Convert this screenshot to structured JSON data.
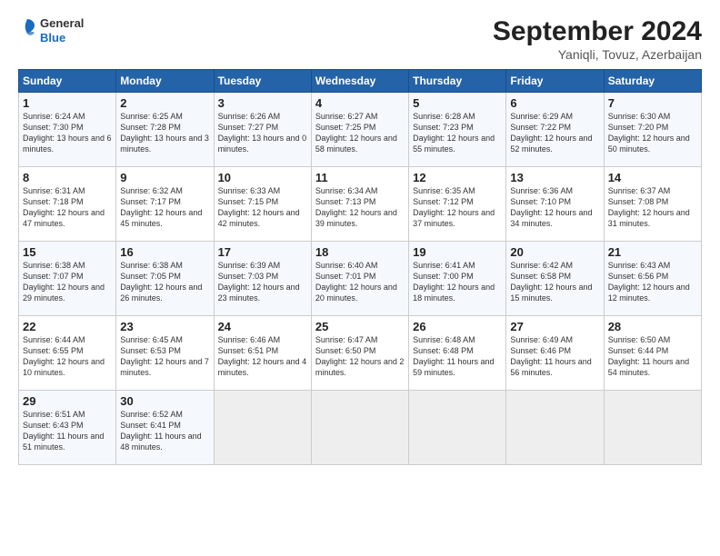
{
  "header": {
    "logo_line1": "General",
    "logo_line2": "Blue",
    "title": "September 2024",
    "subtitle": "Yaniqli, Tovuz, Azerbaijan"
  },
  "columns": [
    "Sunday",
    "Monday",
    "Tuesday",
    "Wednesday",
    "Thursday",
    "Friday",
    "Saturday"
  ],
  "weeks": [
    [
      {
        "day": "1",
        "rise": "Sunrise: 6:24 AM",
        "set": "Sunset: 7:30 PM",
        "day_text": "Daylight: 13 hours and 6 minutes."
      },
      {
        "day": "2",
        "rise": "Sunrise: 6:25 AM",
        "set": "Sunset: 7:28 PM",
        "day_text": "Daylight: 13 hours and 3 minutes."
      },
      {
        "day": "3",
        "rise": "Sunrise: 6:26 AM",
        "set": "Sunset: 7:27 PM",
        "day_text": "Daylight: 13 hours and 0 minutes."
      },
      {
        "day": "4",
        "rise": "Sunrise: 6:27 AM",
        "set": "Sunset: 7:25 PM",
        "day_text": "Daylight: 12 hours and 58 minutes."
      },
      {
        "day": "5",
        "rise": "Sunrise: 6:28 AM",
        "set": "Sunset: 7:23 PM",
        "day_text": "Daylight: 12 hours and 55 minutes."
      },
      {
        "day": "6",
        "rise": "Sunrise: 6:29 AM",
        "set": "Sunset: 7:22 PM",
        "day_text": "Daylight: 12 hours and 52 minutes."
      },
      {
        "day": "7",
        "rise": "Sunrise: 6:30 AM",
        "set": "Sunset: 7:20 PM",
        "day_text": "Daylight: 12 hours and 50 minutes."
      }
    ],
    [
      {
        "day": "8",
        "rise": "Sunrise: 6:31 AM",
        "set": "Sunset: 7:18 PM",
        "day_text": "Daylight: 12 hours and 47 minutes."
      },
      {
        "day": "9",
        "rise": "Sunrise: 6:32 AM",
        "set": "Sunset: 7:17 PM",
        "day_text": "Daylight: 12 hours and 45 minutes."
      },
      {
        "day": "10",
        "rise": "Sunrise: 6:33 AM",
        "set": "Sunset: 7:15 PM",
        "day_text": "Daylight: 12 hours and 42 minutes."
      },
      {
        "day": "11",
        "rise": "Sunrise: 6:34 AM",
        "set": "Sunset: 7:13 PM",
        "day_text": "Daylight: 12 hours and 39 minutes."
      },
      {
        "day": "12",
        "rise": "Sunrise: 6:35 AM",
        "set": "Sunset: 7:12 PM",
        "day_text": "Daylight: 12 hours and 37 minutes."
      },
      {
        "day": "13",
        "rise": "Sunrise: 6:36 AM",
        "set": "Sunset: 7:10 PM",
        "day_text": "Daylight: 12 hours and 34 minutes."
      },
      {
        "day": "14",
        "rise": "Sunrise: 6:37 AM",
        "set": "Sunset: 7:08 PM",
        "day_text": "Daylight: 12 hours and 31 minutes."
      }
    ],
    [
      {
        "day": "15",
        "rise": "Sunrise: 6:38 AM",
        "set": "Sunset: 7:07 PM",
        "day_text": "Daylight: 12 hours and 29 minutes."
      },
      {
        "day": "16",
        "rise": "Sunrise: 6:38 AM",
        "set": "Sunset: 7:05 PM",
        "day_text": "Daylight: 12 hours and 26 minutes."
      },
      {
        "day": "17",
        "rise": "Sunrise: 6:39 AM",
        "set": "Sunset: 7:03 PM",
        "day_text": "Daylight: 12 hours and 23 minutes."
      },
      {
        "day": "18",
        "rise": "Sunrise: 6:40 AM",
        "set": "Sunset: 7:01 PM",
        "day_text": "Daylight: 12 hours and 20 minutes."
      },
      {
        "day": "19",
        "rise": "Sunrise: 6:41 AM",
        "set": "Sunset: 7:00 PM",
        "day_text": "Daylight: 12 hours and 18 minutes."
      },
      {
        "day": "20",
        "rise": "Sunrise: 6:42 AM",
        "set": "Sunset: 6:58 PM",
        "day_text": "Daylight: 12 hours and 15 minutes."
      },
      {
        "day": "21",
        "rise": "Sunrise: 6:43 AM",
        "set": "Sunset: 6:56 PM",
        "day_text": "Daylight: 12 hours and 12 minutes."
      }
    ],
    [
      {
        "day": "22",
        "rise": "Sunrise: 6:44 AM",
        "set": "Sunset: 6:55 PM",
        "day_text": "Daylight: 12 hours and 10 minutes."
      },
      {
        "day": "23",
        "rise": "Sunrise: 6:45 AM",
        "set": "Sunset: 6:53 PM",
        "day_text": "Daylight: 12 hours and 7 minutes."
      },
      {
        "day": "24",
        "rise": "Sunrise: 6:46 AM",
        "set": "Sunset: 6:51 PM",
        "day_text": "Daylight: 12 hours and 4 minutes."
      },
      {
        "day": "25",
        "rise": "Sunrise: 6:47 AM",
        "set": "Sunset: 6:50 PM",
        "day_text": "Daylight: 12 hours and 2 minutes."
      },
      {
        "day": "26",
        "rise": "Sunrise: 6:48 AM",
        "set": "Sunset: 6:48 PM",
        "day_text": "Daylight: 11 hours and 59 minutes."
      },
      {
        "day": "27",
        "rise": "Sunrise: 6:49 AM",
        "set": "Sunset: 6:46 PM",
        "day_text": "Daylight: 11 hours and 56 minutes."
      },
      {
        "day": "28",
        "rise": "Sunrise: 6:50 AM",
        "set": "Sunset: 6:44 PM",
        "day_text": "Daylight: 11 hours and 54 minutes."
      }
    ],
    [
      {
        "day": "29",
        "rise": "Sunrise: 6:51 AM",
        "set": "Sunset: 6:43 PM",
        "day_text": "Daylight: 11 hours and 51 minutes."
      },
      {
        "day": "30",
        "rise": "Sunrise: 6:52 AM",
        "set": "Sunset: 6:41 PM",
        "day_text": "Daylight: 11 hours and 48 minutes."
      },
      null,
      null,
      null,
      null,
      null
    ]
  ]
}
